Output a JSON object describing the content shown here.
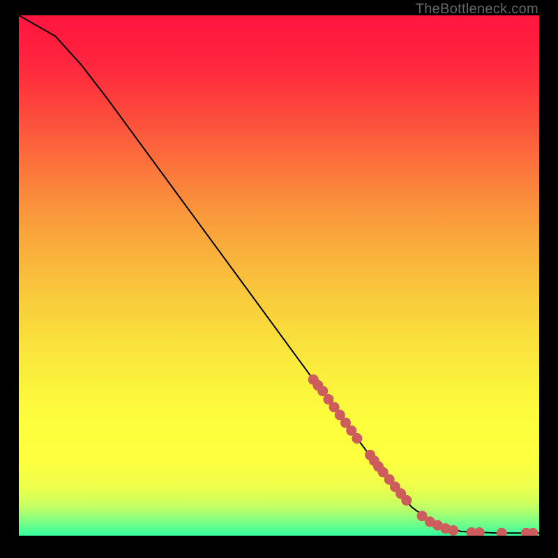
{
  "source_watermark": "TheBottleneck.com",
  "colors": {
    "gradient_stops": [
      {
        "offset": 0.0,
        "color": "#ff163f"
      },
      {
        "offset": 0.06,
        "color": "#ff1e3e"
      },
      {
        "offset": 0.12,
        "color": "#fe2f3d"
      },
      {
        "offset": 0.18,
        "color": "#fd463c"
      },
      {
        "offset": 0.24,
        "color": "#fc5f3c"
      },
      {
        "offset": 0.3,
        "color": "#fb783b"
      },
      {
        "offset": 0.36,
        "color": "#fa903b"
      },
      {
        "offset": 0.42,
        "color": "#f9a53b"
      },
      {
        "offset": 0.48,
        "color": "#f9b83b"
      },
      {
        "offset": 0.54,
        "color": "#f9ca3b"
      },
      {
        "offset": 0.6,
        "color": "#f9da3b"
      },
      {
        "offset": 0.66,
        "color": "#fae83c"
      },
      {
        "offset": 0.72,
        "color": "#fbf43c"
      },
      {
        "offset": 0.76,
        "color": "#fcfb3d"
      },
      {
        "offset": 0.8,
        "color": "#fdff3d"
      },
      {
        "offset": 0.855,
        "color": "#feff3e"
      },
      {
        "offset": 0.905,
        "color": "#eeff4a"
      },
      {
        "offset": 0.93,
        "color": "#d7ff59"
      },
      {
        "offset": 0.95,
        "color": "#b7ff6a"
      },
      {
        "offset": 0.965,
        "color": "#92ff7b"
      },
      {
        "offset": 0.98,
        "color": "#6bff8b"
      },
      {
        "offset": 0.992,
        "color": "#47ff99"
      },
      {
        "offset": 1.0,
        "color": "#37ff9e"
      }
    ],
    "curve_stroke": "#000000",
    "dot_fill": "#CD5C5C",
    "frame": "#000000",
    "watermark_text": "#666666"
  },
  "chart_data": {
    "type": "line",
    "title": "",
    "xlabel": "",
    "ylabel": "",
    "xlim": [
      0,
      1
    ],
    "ylim": [
      0,
      1
    ],
    "series": [
      {
        "name": "curve",
        "kind": "line",
        "points": [
          {
            "x": 0.0,
            "y": 1.0
          },
          {
            "x": 0.07,
            "y": 0.96
          },
          {
            "x": 0.12,
            "y": 0.905
          },
          {
            "x": 0.17,
            "y": 0.84
          },
          {
            "x": 0.302,
            "y": 0.66
          },
          {
            "x": 0.434,
            "y": 0.48
          },
          {
            "x": 0.566,
            "y": 0.3
          },
          {
            "x": 0.7,
            "y": 0.12
          },
          {
            "x": 0.755,
            "y": 0.055
          },
          {
            "x": 0.8,
            "y": 0.022
          },
          {
            "x": 0.85,
            "y": 0.008
          },
          {
            "x": 0.92,
            "y": 0.005
          },
          {
            "x": 1.0,
            "y": 0.005
          }
        ]
      },
      {
        "name": "dots_upper_cluster",
        "kind": "scatter",
        "points": [
          {
            "x": 0.566,
            "y": 0.3
          },
          {
            "x": 0.575,
            "y": 0.289
          },
          {
            "x": 0.584,
            "y": 0.278
          },
          {
            "x": 0.595,
            "y": 0.262
          },
          {
            "x": 0.606,
            "y": 0.247
          },
          {
            "x": 0.617,
            "y": 0.232
          },
          {
            "x": 0.628,
            "y": 0.217
          },
          {
            "x": 0.639,
            "y": 0.202
          },
          {
            "x": 0.65,
            "y": 0.187
          }
        ]
      },
      {
        "name": "dots_mid_cluster",
        "kind": "scatter",
        "points": [
          {
            "x": 0.675,
            "y": 0.155
          },
          {
            "x": 0.683,
            "y": 0.144
          },
          {
            "x": 0.691,
            "y": 0.133
          },
          {
            "x": 0.7,
            "y": 0.122
          },
          {
            "x": 0.712,
            "y": 0.108
          },
          {
            "x": 0.723,
            "y": 0.094
          },
          {
            "x": 0.734,
            "y": 0.081
          },
          {
            "x": 0.745,
            "y": 0.068
          }
        ]
      },
      {
        "name": "dots_lower_cluster",
        "kind": "scatter",
        "points": [
          {
            "x": 0.775,
            "y": 0.038
          },
          {
            "x": 0.79,
            "y": 0.027
          },
          {
            "x": 0.805,
            "y": 0.02
          },
          {
            "x": 0.82,
            "y": 0.014
          },
          {
            "x": 0.835,
            "y": 0.01
          }
        ]
      },
      {
        "name": "dots_tail",
        "kind": "scatter",
        "points": [
          {
            "x": 0.87,
            "y": 0.006
          },
          {
            "x": 0.885,
            "y": 0.006
          },
          {
            "x": 0.928,
            "y": 0.005
          },
          {
            "x": 0.975,
            "y": 0.005
          },
          {
            "x": 0.988,
            "y": 0.005
          }
        ]
      }
    ]
  }
}
